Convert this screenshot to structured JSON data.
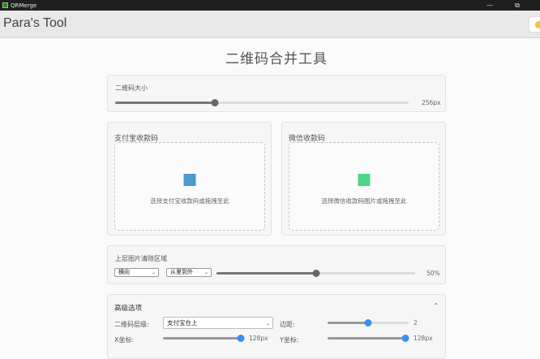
{
  "window": {
    "title": "QRMerge",
    "minimize": "—",
    "maximize": "⧉"
  },
  "appbar": {
    "title": "Para's Tool"
  },
  "page": {
    "title": "二维码合并工具"
  },
  "size_card": {
    "label": "二维码大小",
    "value": "256px",
    "fraction": 0.34
  },
  "alipay": {
    "title": "支付宝收款码",
    "hint": "选择支付宝收款码或拖拽至此",
    "color": "#4a9bd0"
  },
  "wechat": {
    "title": "微信收款码",
    "hint": "选择微信收款码图片或拖拽至此",
    "color": "#4dd486"
  },
  "clear_card": {
    "label": "上层图片清除区域",
    "direction": {
      "value": "横向"
    },
    "order": {
      "value": "从里到外"
    },
    "value": "50%",
    "fraction": 0.5
  },
  "advanced": {
    "title": "高级选项",
    "layer": {
      "label": "二维码层级:",
      "value": "支付宝在上"
    },
    "margin": {
      "label": "边距:",
      "value": "2",
      "fraction": 0.5
    },
    "x": {
      "label": "X坐标:",
      "value": "128px",
      "fraction": 1.0
    },
    "y": {
      "label": "Y坐标:",
      "value": "128px",
      "fraction": 1.0
    }
  }
}
